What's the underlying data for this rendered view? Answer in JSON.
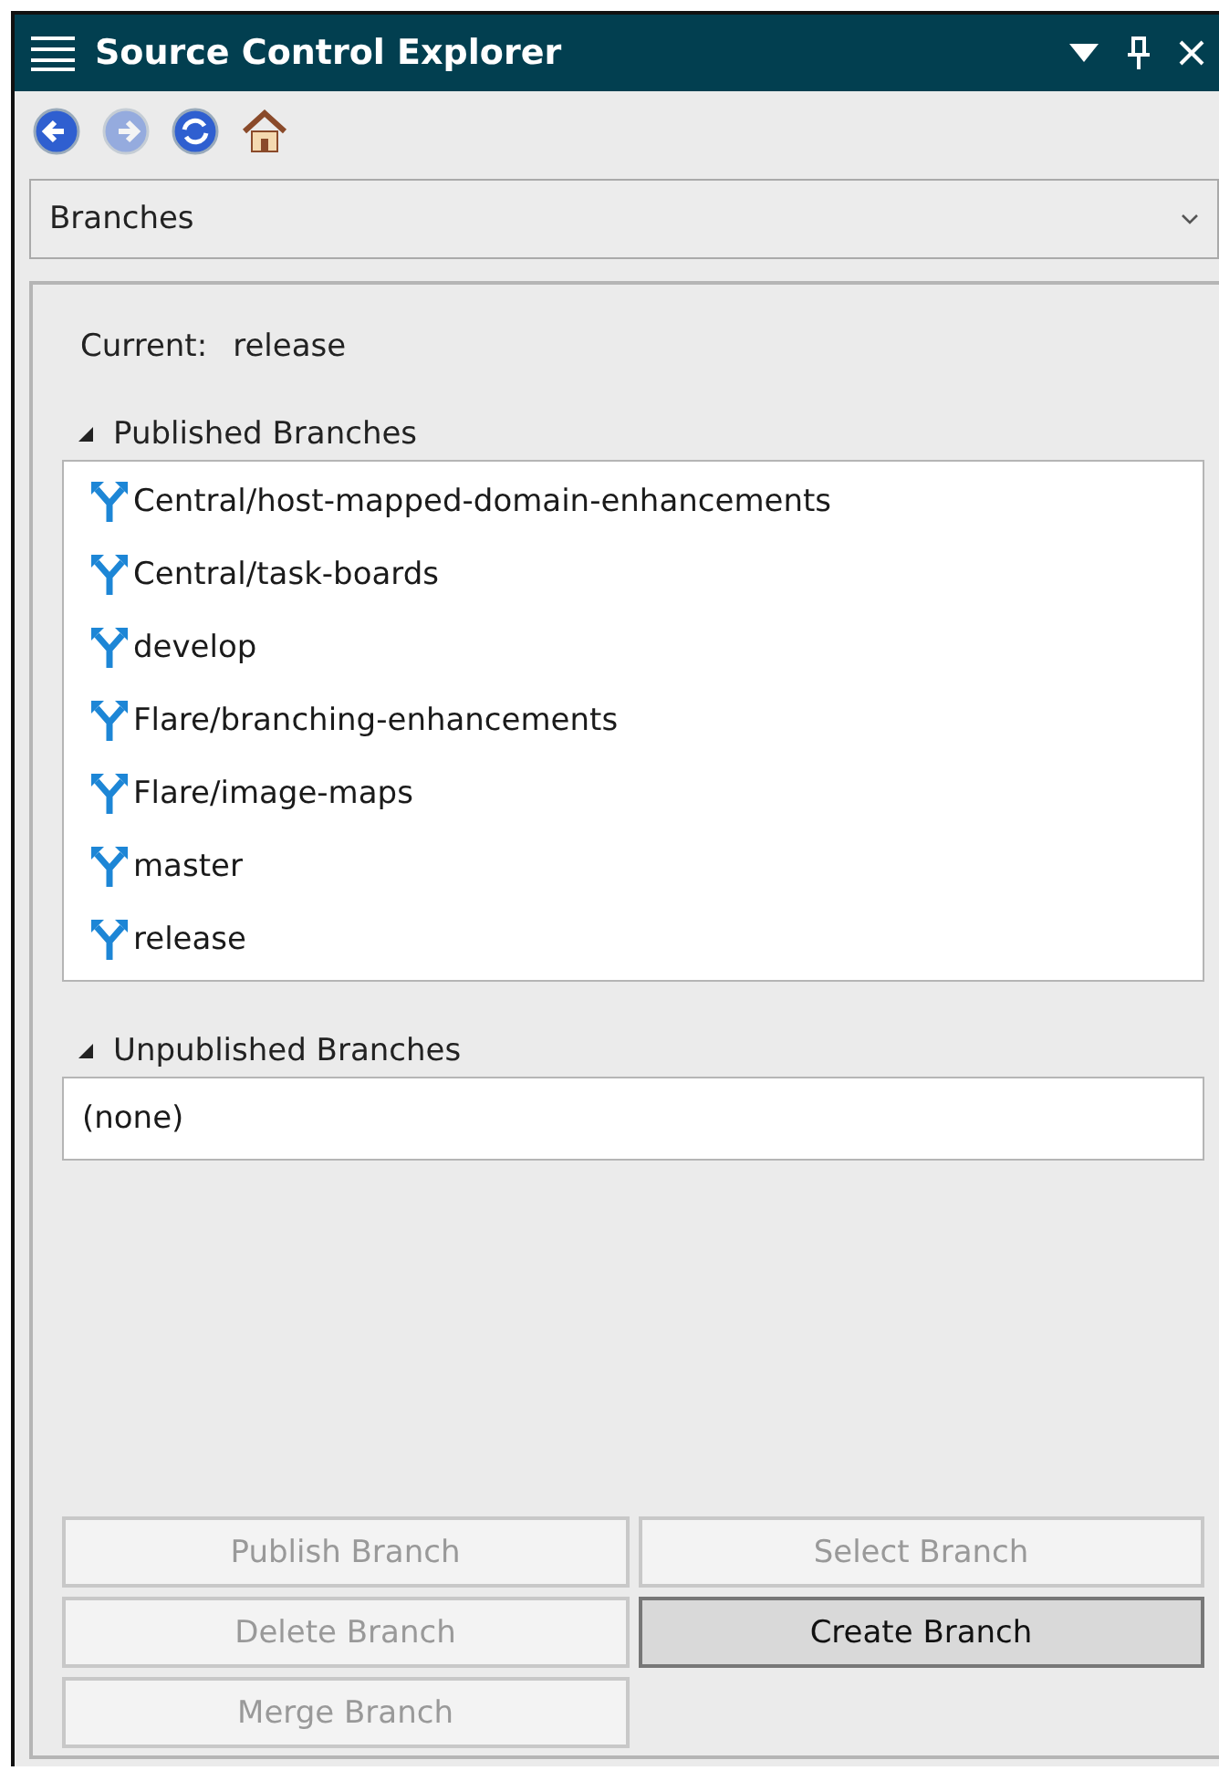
{
  "window": {
    "title": "Source Control Explorer"
  },
  "toolbar": [
    {
      "kind": "back",
      "disabled": false
    },
    {
      "kind": "forward",
      "disabled": true
    },
    {
      "kind": "refresh",
      "disabled": false
    },
    {
      "kind": "home",
      "disabled": false
    }
  ],
  "view_select": {
    "value": "Branches"
  },
  "current": {
    "label": "Current:",
    "value": "release"
  },
  "sections": [
    {
      "title": "Published Branches",
      "expanded": true,
      "items": [
        "Central/host-mapped-domain-enhancements",
        "Central/task-boards",
        "develop",
        "Flare/branching-enhancements",
        "Flare/image-maps",
        "master",
        "release"
      ]
    },
    {
      "title": "Unpublished Branches",
      "expanded": true,
      "empty_text": "(none)"
    }
  ],
  "buttons": [
    {
      "label": "Publish Branch",
      "disabled": true
    },
    {
      "label": "Select Branch",
      "disabled": true
    },
    {
      "label": "Delete Branch",
      "disabled": true
    },
    {
      "label": "Create Branch",
      "disabled": false
    },
    {
      "label": "Merge Branch",
      "disabled": true
    }
  ]
}
